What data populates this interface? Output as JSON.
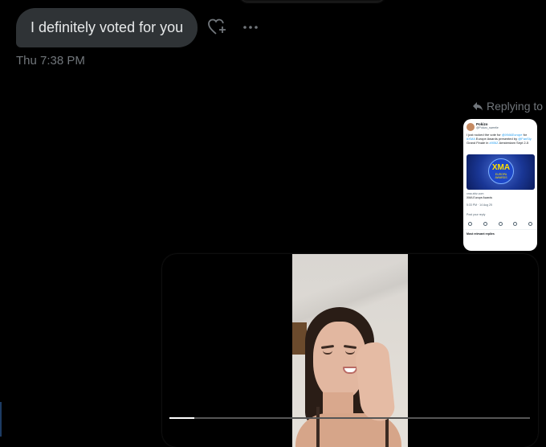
{
  "conversation": {
    "message": {
      "text": "I definitely voted for you"
    },
    "timestamp": "Thu 7:38 PM",
    "reply_label": "Replying to"
  },
  "quoted_tweet": {
    "name": "Pokizo",
    "handle": "@Pokizo_sweetie",
    "text_before": "I just rocked the vote for ",
    "link1": "@XMAEurope",
    "text_mid": " for ",
    "link2": "#XMA",
    "text_after": " Europe Awards presented by ",
    "link3": "@FanSly",
    "text_end": " Grand Finale in ",
    "link4": "#XBIZ",
    "text_tail": " Amsterdam Sept 2-5",
    "card_logo": "XMA",
    "card_logo_sub": "EUROPA AWARDS",
    "card_source": "xma.xbiz.com",
    "card_title": "XMA Europe Awards",
    "time": "5:33 PM · 14 Aug 25",
    "reply_hint": "Post your reply",
    "most_relevant": "Most relevant replies"
  },
  "video": {
    "progress_percent": 7
  },
  "icons": [
    "heart-plus-icon",
    "more-icon",
    "reply-arrow-icon"
  ],
  "colors": {
    "bubble": "#2f3336",
    "muted": "#71767b",
    "link": "#1d9bf0",
    "background": "#000000"
  }
}
